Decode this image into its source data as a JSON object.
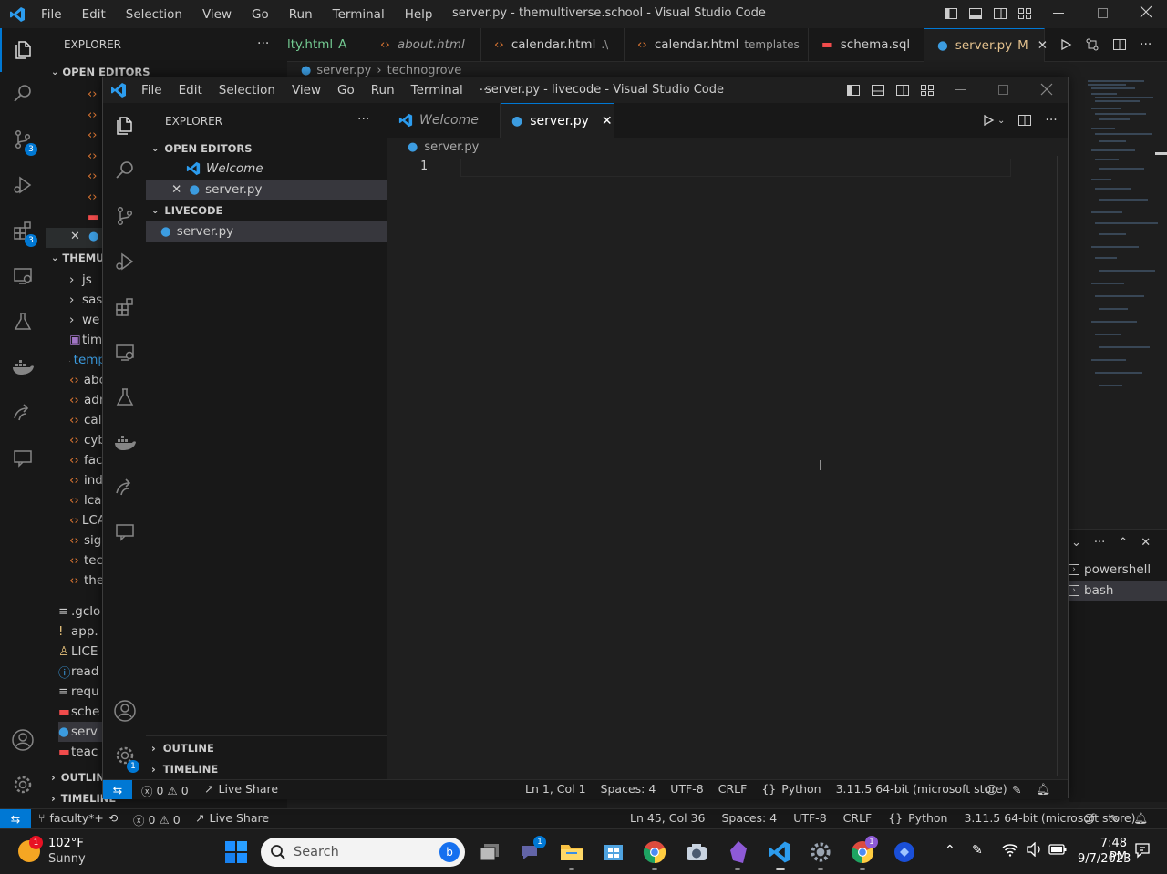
{
  "bg_window": {
    "menu": [
      "File",
      "Edit",
      "Selection",
      "View",
      "Go",
      "Run",
      "Terminal",
      "Help"
    ],
    "title": "server.py - themultiverse.school - Visual Studio Code",
    "sidebar_title": "EXPLORER",
    "open_editors_label": "OPEN EDITORS",
    "project_label": "THEMU",
    "tree_items": [
      "js",
      "sas",
      "we",
      "tim",
      "temp",
      "abc",
      "adr",
      "cal",
      "cyb",
      "fac",
      "ind",
      "lcai",
      "LCA",
      "sig",
      "tec",
      "the",
      ".gclo",
      "app.",
      "LICE",
      "read",
      "requ",
      "sche",
      "serv",
      "teac"
    ],
    "outline_label": "OUTLIN",
    "timeline_label": "TIMELINE",
    "tabs": [
      {
        "label": "lty.html",
        "suffix": "A"
      },
      {
        "label": "about.html",
        "suffix": ""
      },
      {
        "label": "calendar.html",
        "suffix": ".\\"
      },
      {
        "label": "calendar.html",
        "suffix": "templates"
      },
      {
        "label": "schema.sql",
        "suffix": ""
      },
      {
        "label": "server.py",
        "suffix": "M"
      }
    ],
    "breadcrumb": [
      "server.py",
      "technogrove"
    ],
    "panel_items": [
      "powershell",
      "bash"
    ],
    "status": {
      "branch": "faculty*+",
      "errors": "0",
      "warnings": "0",
      "live_share": "Live Share",
      "position": "Ln 45, Col 36",
      "spaces": "Spaces: 4",
      "encoding": "UTF-8",
      "eol": "CRLF",
      "language": "Python",
      "interpreter": "3.11.5 64-bit (microsoft store)"
    }
  },
  "fg_window": {
    "menu": [
      "File",
      "Edit",
      "Selection",
      "View",
      "Go",
      "Run",
      "Terminal",
      "···"
    ],
    "title": "server.py - livecode - Visual Studio Code",
    "sidebar_title": "EXPLORER",
    "open_editors_label": "OPEN EDITORS",
    "open_editors": [
      "Welcome",
      "server.py"
    ],
    "folder_label": "LIVECODE",
    "folder_files": [
      "server.py"
    ],
    "outline_label": "OUTLINE",
    "timeline_label": "TIMELINE",
    "tabs": [
      {
        "label": "Welcome"
      },
      {
        "label": "server.py"
      }
    ],
    "breadcrumb": "server.py",
    "line_number": "1",
    "status": {
      "errors": "0",
      "warnings": "0",
      "live_share": "Live Share",
      "position": "Ln 1, Col 1",
      "spaces": "Spaces: 4",
      "encoding": "UTF-8",
      "eol": "CRLF",
      "language": "Python",
      "interpreter": "3.11.5 64-bit (microsoft store)"
    },
    "settings_badge": "1"
  },
  "badges": {
    "source_control": "3",
    "extensions": "3"
  },
  "taskbar": {
    "weather_temp": "102°F",
    "weather_desc": "Sunny",
    "weather_badge": "1",
    "search_placeholder": "Search",
    "teams_badge": "1",
    "chrome2_badge": "1",
    "time": "7:48 PM",
    "date": "9/7/2023"
  },
  "colors": {
    "accent": "#0078d4",
    "python": "#3c9ce0",
    "html": "#e37933",
    "sql": "#f14c4c",
    "remote": "#0078d4"
  }
}
